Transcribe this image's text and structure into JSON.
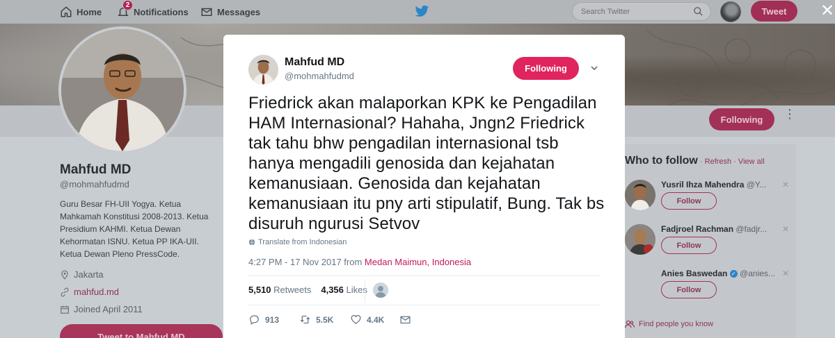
{
  "nav": {
    "home_label": "Home",
    "notifications_label": "Notifications",
    "notifications_badge": "2",
    "messages_label": "Messages",
    "search_placeholder": "Search Twitter",
    "tweet_button": "Tweet",
    "close_glyph": "✕"
  },
  "profile": {
    "name": "Mahfud MD",
    "handle": "@mohmahfudmd",
    "bio": "Guru Besar FH-UII Yogya. Ketua Mahkamah Konstitusi 2008-2013. Ketua Presidium KAHMI. Ketua Dewan Kehormatan ISNU. Ketua PP IKA-UII. Ketua Dewan Pleno PressCode.",
    "location": "Jakarta",
    "website": "mahfud.md",
    "joined": "Joined April 2011",
    "following_button": "Following",
    "tweet_to_button": "Tweet to Mahfud MD"
  },
  "who_to_follow": {
    "title": "Who to follow",
    "links": " · Refresh · View all",
    "follow_label": "Follow",
    "users": [
      {
        "name": "Yusril Ihza Mahendra",
        "handle": " @Y..."
      },
      {
        "name": "Fadjroel Rachman",
        "handle": " @fadjr..."
      },
      {
        "name": "Anies Baswedan",
        "handle": " @anies..."
      }
    ],
    "find_people": "Find people you know"
  },
  "tweet": {
    "author_name": "Mahfud MD",
    "author_handle": "@mohmahfudmd",
    "following_button": "Following",
    "text": "Friedrick akan malaporkan KPK ke Pengadilan HAM Internasional? Hahaha, Jngn2 Friedrick tak tahu bhw  pengadilan internasional tsb hanya mengadili genosida dan kejahatan kemanusiaan. Genosida dan kejahatan kemanusiaan itu pny arti stipulatif, Bung. Tak bs disuruh ngurusi Setvov",
    "translate_label": "Translate from Indonesian",
    "timestamp": "4:27 PM - 17 Nov 2017 from ",
    "location": "Medan Maimun, Indonesia",
    "retweets_count": "5,510",
    "retweets_label": " Retweets",
    "likes_count": "4,356",
    "likes_label": " Likes",
    "replies_action": "913",
    "retweets_action": "5.5K",
    "likes_action": "4.4K"
  },
  "colors": {
    "accent": "#e0245e",
    "twitter_blue": "#1da1f2",
    "dimmed_nav": "#b3b6b9"
  }
}
